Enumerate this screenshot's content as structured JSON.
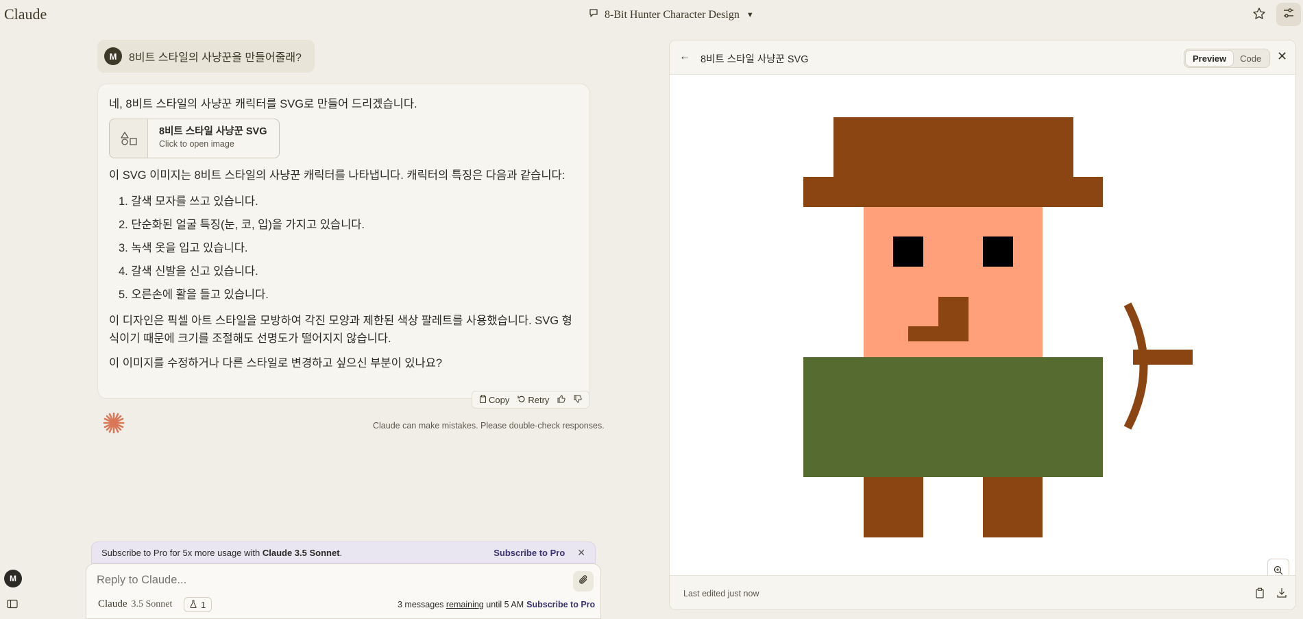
{
  "app": {
    "logo": "Claude"
  },
  "header": {
    "conversation_title": "8-Bit Hunter Character Design"
  },
  "user_message": {
    "avatar": "M",
    "text": "8비트 스타일의 사냥꾼을 만들어줄래?"
  },
  "assistant": {
    "intro": "네, 8비트 스타일의 사냥꾼 캐릭터를 SVG로 만들어 드리겠습니다.",
    "artifact_card": {
      "title": "8비트 스타일 사냥꾼 SVG",
      "subtitle": "Click to open image"
    },
    "para1": "이 SVG 이미지는 8비트 스타일의 사냥꾼 캐릭터를 나타냅니다. 캐릭터의 특징은 다음과 같습니다:",
    "features": [
      "1. 갈색 모자를 쓰고 있습니다.",
      "2. 단순화된 얼굴 특징(눈, 코, 입)을 가지고 있습니다.",
      "3. 녹색 옷을 입고 있습니다.",
      "4. 갈색 신발을 신고 있습니다.",
      "5. 오른손에 활을 들고 있습니다."
    ],
    "para2": "이 디자인은 픽셀 아트 스타일을 모방하여 각진 모양과 제한된 색상 팔레트를 사용했습니다. SVG 형식이기 때문에 크기를 조절해도 선명도가 떨어지지 않습니다.",
    "para3": "이 이미지를 수정하거나 다른 스타일로 변경하고 싶으신 부분이 있나요?",
    "actions": {
      "copy": "Copy",
      "retry": "Retry"
    },
    "disclaimer": "Claude can make mistakes. Please double-check responses."
  },
  "banner": {
    "text_prefix": "Subscribe to Pro for 5x more usage with ",
    "text_model": "Claude 3.5 Sonnet",
    "text_suffix": ".",
    "link": "Subscribe to Pro"
  },
  "composer": {
    "placeholder": "Reply to Claude...",
    "model_name": "Claude",
    "model_version": "3.5 Sonnet",
    "project_count": "1",
    "remaining_prefix": "3 messages ",
    "remaining_word": "remaining",
    "remaining_suffix": " until 5 AM",
    "subscribe": "Subscribe to Pro"
  },
  "sidebar": {
    "avatar": "M"
  },
  "artifact_panel": {
    "title": "8비트 스타일 사냥꾼 SVG",
    "tabs": [
      "Preview",
      "Code"
    ],
    "active_tab": "Preview",
    "footer": "Last edited just now"
  },
  "colors": {
    "hat": "#8b4513",
    "skin": "#ffa07a",
    "shirt": "#556b2f",
    "eyes": "#000000",
    "accent": "#d97757"
  }
}
